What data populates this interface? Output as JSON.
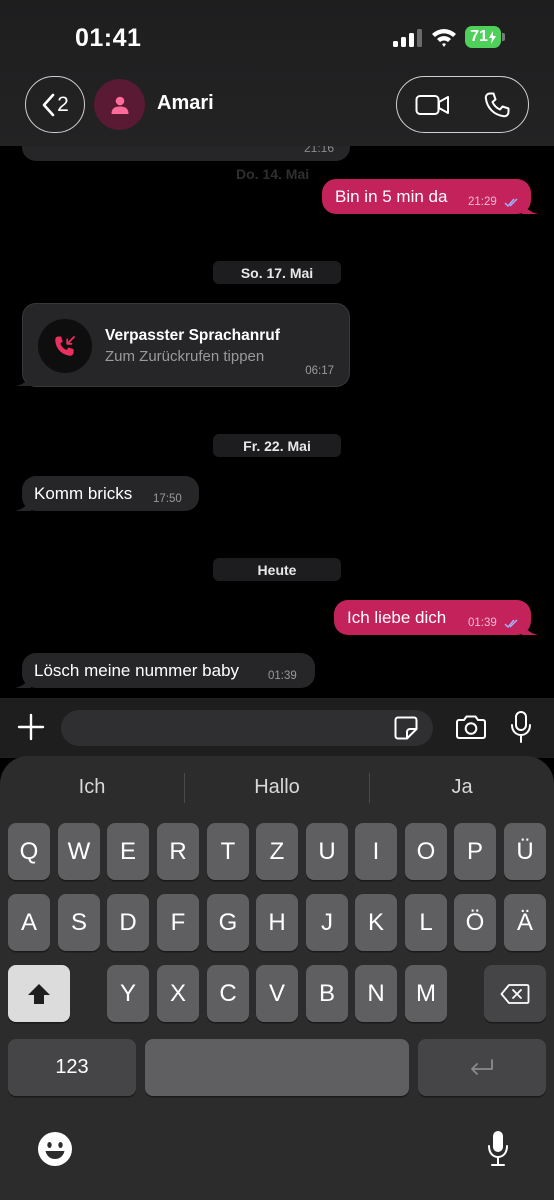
{
  "status_bar": {
    "time": "01:41",
    "battery": "71"
  },
  "header": {
    "back_count": "2",
    "contact_name": "Amari",
    "accent": "#c4225a"
  },
  "chat": {
    "partial_time": "21:16",
    "faded_date": "Do. 14. Mai",
    "messages": [
      {
        "text": "Bin in 5 min da",
        "time": "21:29",
        "dir": "out"
      },
      {
        "text": "Komm bricks",
        "time": "17:50",
        "dir": "in"
      },
      {
        "text": "Ich liebe dich",
        "time": "01:39",
        "dir": "out"
      },
      {
        "text": "Lösch meine nummer baby",
        "time": "01:39",
        "dir": "in"
      }
    ],
    "dates": [
      "So. 17. Mai",
      "Fr. 22. Mai",
      "Heute"
    ],
    "missed_call": {
      "title": "Verpasster Sprachanruf",
      "subtitle": "Zum Zurückrufen tippen",
      "time": "06:17"
    }
  },
  "composer": {
    "value": "",
    "placeholder": ""
  },
  "keyboard": {
    "suggestions": [
      "Ich",
      "Hallo",
      "Ja"
    ],
    "row1": [
      "Q",
      "W",
      "E",
      "R",
      "T",
      "Z",
      "U",
      "I",
      "O",
      "P",
      "Ü"
    ],
    "row2": [
      "A",
      "S",
      "D",
      "F",
      "G",
      "H",
      "J",
      "K",
      "L",
      "Ö",
      "Ä"
    ],
    "row3": [
      "Y",
      "X",
      "C",
      "V",
      "B",
      "N",
      "M"
    ],
    "numbers_key": "123"
  }
}
